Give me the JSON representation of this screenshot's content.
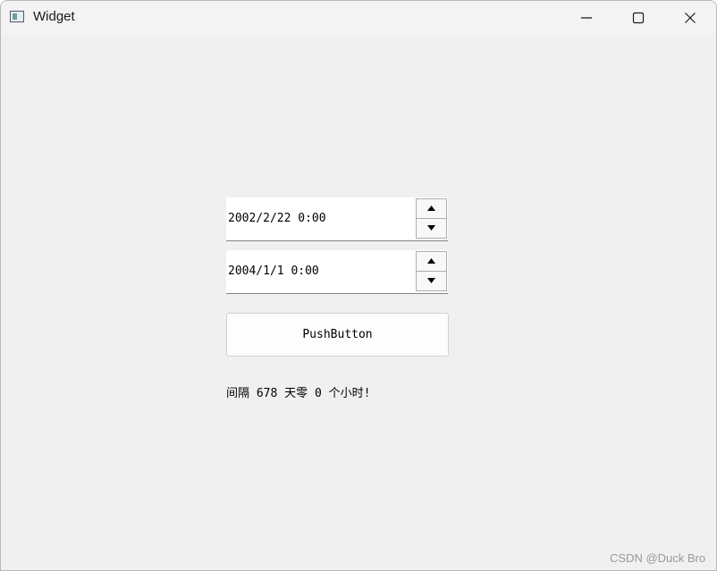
{
  "window": {
    "title": "Widget",
    "icon": "app-window-icon",
    "controls": {
      "minimize_icon": "minimize-icon",
      "maximize_icon": "maximize-icon",
      "close_icon": "close-icon"
    }
  },
  "form": {
    "start_datetime": "2002/2/22 0:00",
    "end_datetime": "2004/1/1 0:00",
    "spin_up_icon": "arrow-up-icon",
    "spin_down_icon": "arrow-down-icon",
    "push_button_label": "PushButton",
    "result_text": "间隔 678 天零 0 个小时!"
  },
  "watermark": "CSDN @Duck Bro",
  "colors": {
    "window_bg": "#f0f0f0",
    "titlebar_bg": "#f3f3f3",
    "field_bg": "#ffffff",
    "text": "#000000",
    "watermark": "#9a9a9a"
  }
}
